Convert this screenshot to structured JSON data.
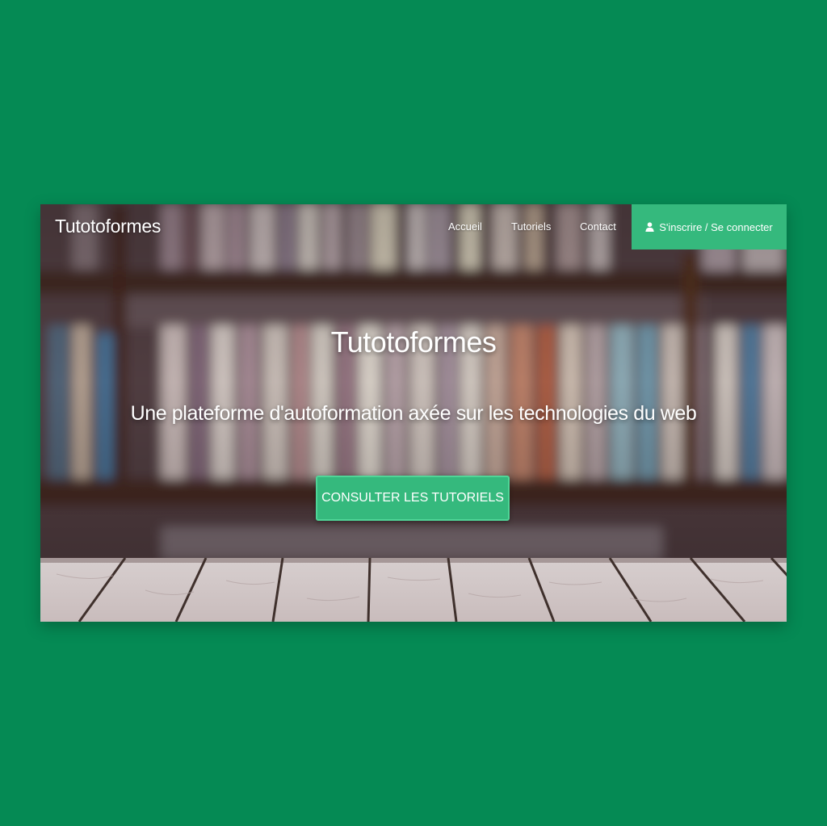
{
  "navbar": {
    "brand": "Tutotoformes",
    "links": {
      "home": "Accueil",
      "tutorials": "Tutoriels",
      "contact": "Contact"
    },
    "login": {
      "icon": "user-icon",
      "label": "S'inscrire / Se connecter"
    }
  },
  "hero": {
    "title": "Tutotoformes",
    "subtitle": "Une plateforme d'autoformation axée sur les technologies du web",
    "cta_label": "CONSULTER LES TUTORIELS",
    "background": "blurred bookshelf over wooden planks"
  },
  "colors": {
    "page_background": "#058a54",
    "accent": "#35b97d",
    "accent_border": "#4fd597",
    "text": "#ffffff"
  }
}
